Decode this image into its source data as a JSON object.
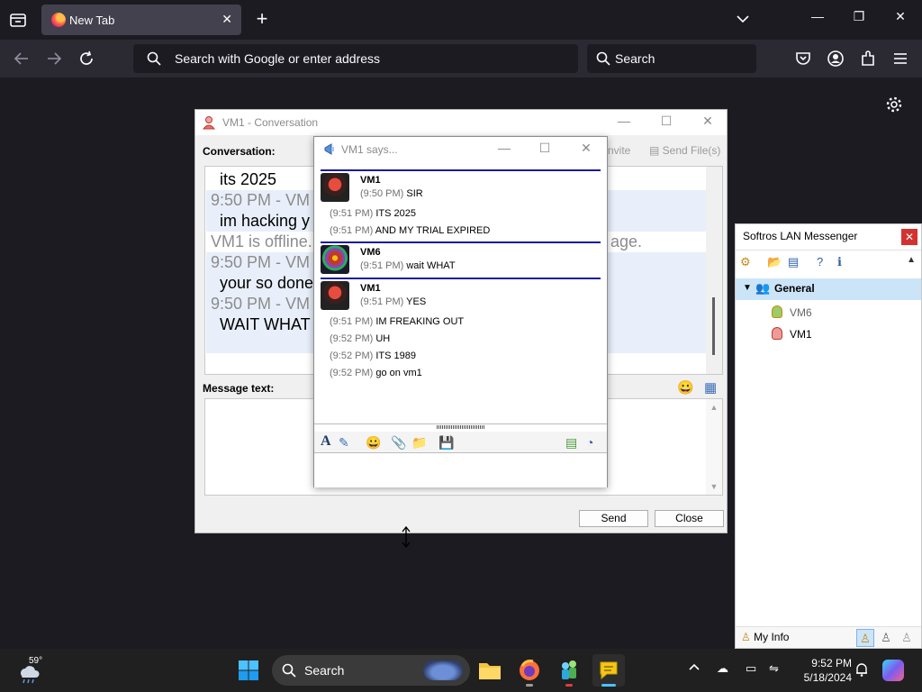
{
  "browser": {
    "tab_title": "New Tab",
    "url_placeholder": "Search with Google or enter address",
    "search_placeholder": "Search"
  },
  "conversation": {
    "title": "VM1 - Conversation",
    "conv_label": "Conversation:",
    "invite_label": "nvite",
    "send_file_label": "Send File(s)",
    "log": [
      {
        "text": "its 2025",
        "kind": "body"
      },
      {
        "text": "9:50 PM - VM",
        "kind": "meta"
      },
      {
        "text": "im hacking y",
        "kind": "body"
      },
      {
        "text": "VM1 is offline.",
        "kind": "meta"
      },
      {
        "text": "age.",
        "kind": "meta"
      },
      {
        "text": "9:50 PM - VM",
        "kind": "meta"
      },
      {
        "text": "your so done",
        "kind": "body"
      },
      {
        "text": "9:50 PM - VM",
        "kind": "meta"
      },
      {
        "text": "WAIT WHAT",
        "kind": "body"
      }
    ],
    "msg_label": "Message text:",
    "send_label": "Send",
    "close_label": "Close"
  },
  "popup": {
    "title": "VM1 says...",
    "blocks": [
      {
        "sender": "VM1",
        "messages": [
          {
            "time": "(9:50 PM)",
            "text": "SIR"
          },
          {
            "time": "(9:51 PM)",
            "text": "ITS 2025"
          },
          {
            "time": "(9:51 PM)",
            "text": "AND MY TRIAL EXPIRED"
          }
        ]
      },
      {
        "sender": "VM6",
        "messages": [
          {
            "time": "(9:51 PM)",
            "text": "wait WHAT"
          }
        ]
      },
      {
        "sender": "VM1",
        "messages": [
          {
            "time": "(9:51 PM)",
            "text": "YES"
          },
          {
            "time": "(9:51 PM)",
            "text": "IM FREAKING OUT"
          },
          {
            "time": "(9:52 PM)",
            "text": "UH"
          },
          {
            "time": "(9:52 PM)",
            "text": "ITS 1989"
          },
          {
            "time": "(9:52 PM)",
            "text": "go on vm1"
          }
        ]
      }
    ]
  },
  "lan": {
    "title": "Softros LAN Messenger",
    "group": "General",
    "users": [
      "VM6",
      "VM1"
    ],
    "my_info": "My Info"
  },
  "taskbar": {
    "temperature": "59°",
    "search_label": "Search",
    "time": "9:52 PM",
    "date": "5/18/2024"
  },
  "colors": {
    "accent_blue": "#1b1b9c",
    "firefox_bg": "#1c1b22",
    "close_red": "#d43131"
  }
}
